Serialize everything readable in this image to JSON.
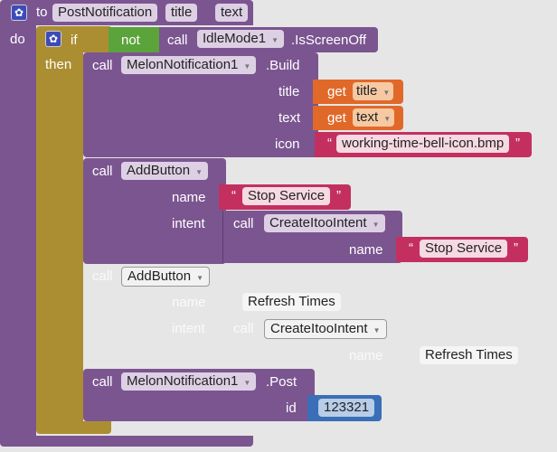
{
  "procedure": {
    "to": "to",
    "name": "PostNotification",
    "params": [
      "title",
      "text"
    ],
    "do": "do"
  },
  "if_block": {
    "if": "if",
    "then": "then"
  },
  "condition": {
    "not": "not",
    "call": "call",
    "component": "IdleMode1",
    "method": ".IsScreenOff"
  },
  "build": {
    "call": "call",
    "component": "MelonNotification1",
    "method": ".Build",
    "args": [
      {
        "label": "title",
        "get": "get",
        "value": "title"
      },
      {
        "label": "text",
        "get": "get",
        "value": "text"
      },
      {
        "label": "icon",
        "value": "working-time-bell-icon.bmp"
      }
    ]
  },
  "add_button_1": {
    "call": "call",
    "method": "AddButton",
    "name_label": "name",
    "name_value": "Stop Service",
    "intent_label": "intent",
    "intent_call": "call",
    "intent_method": "CreateItooIntent",
    "intent_name_label": "name",
    "intent_name_value": "Stop Service"
  },
  "add_button_2": {
    "disabled": true,
    "call": "call",
    "method": "AddButton",
    "name_label": "name",
    "name_value": "Refresh Times",
    "intent_label": "intent",
    "intent_call": "call",
    "intent_method": "CreateItooIntent",
    "intent_name_label": "name",
    "intent_name_value": "Refresh Times"
  },
  "post": {
    "call": "call",
    "component": "MelonNotification1",
    "method": ".Post",
    "id_label": "id",
    "id_value": "123321"
  },
  "colors": {
    "procedure": "#7b5590",
    "control": "#ab8e31",
    "logic": "#5ba33b",
    "variable": "#e0692a",
    "text": "#c3305f",
    "math": "#3a6fb8"
  }
}
